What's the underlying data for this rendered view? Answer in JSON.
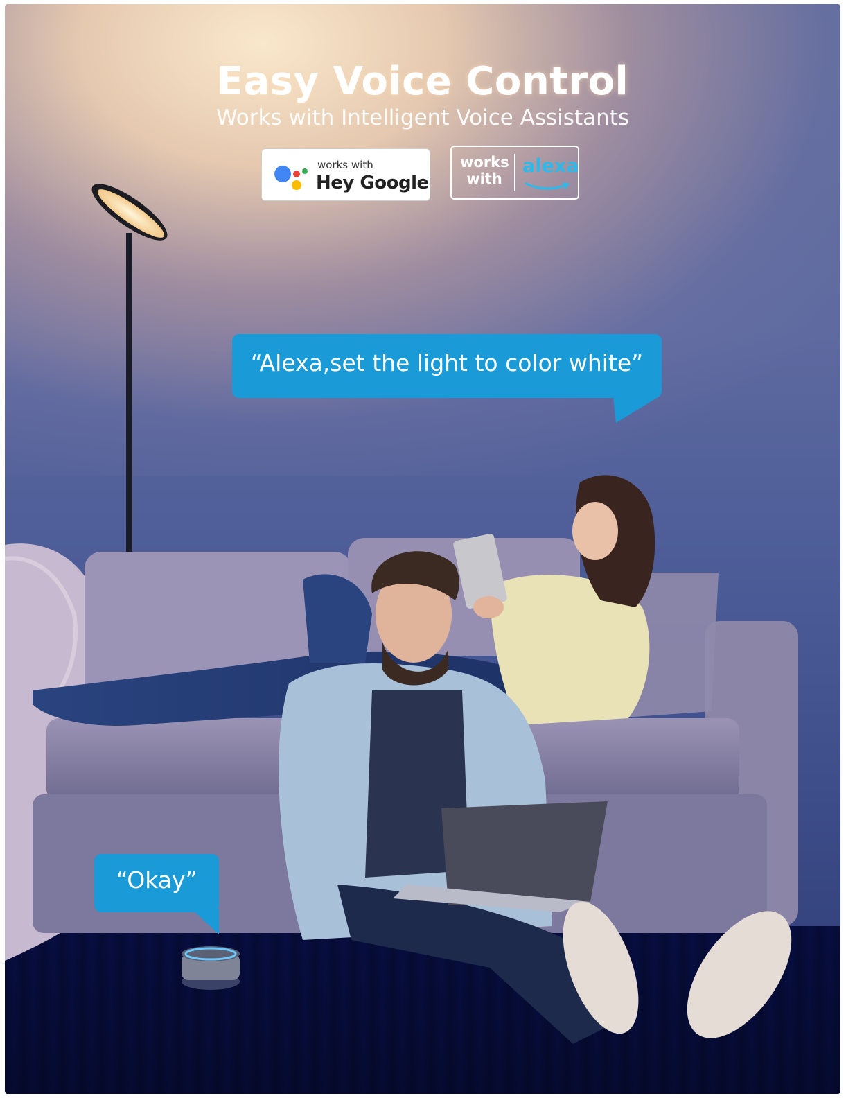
{
  "header": {
    "title": "Easy Voice Control",
    "subtitle": "Works with Intelligent Voice Assistants"
  },
  "badges": {
    "google": {
      "small": "works with",
      "big": "Hey Google"
    },
    "alexa": {
      "works": "works",
      "with": "with",
      "brand": "alexa"
    }
  },
  "speech": {
    "command": "“Alexa,set the light to color white”",
    "reply": "“Okay”"
  },
  "colors": {
    "bubble": "#1a9ad6",
    "alexa_brand": "#2fb8e8",
    "wall": "#5d6b9e",
    "warm_light": "#ffecc8"
  }
}
